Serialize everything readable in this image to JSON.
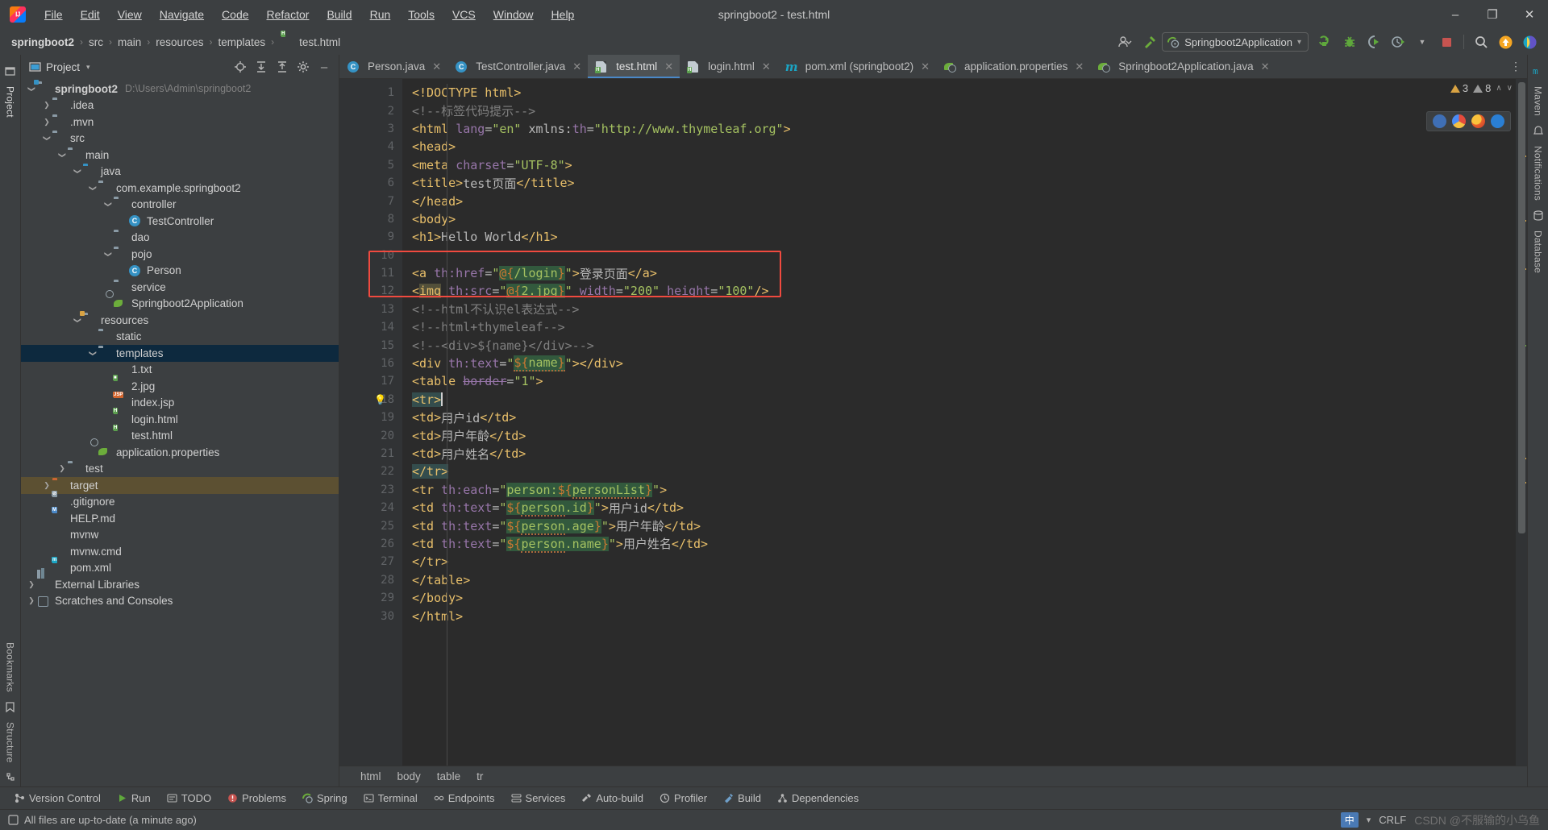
{
  "window": {
    "title": "springboot2 - test.html",
    "minimize_label": "–",
    "maximize_label": "❐",
    "close_label": "✕"
  },
  "menu": {
    "items": [
      {
        "label": "File"
      },
      {
        "label": "Edit"
      },
      {
        "label": "View"
      },
      {
        "label": "Navigate"
      },
      {
        "label": "Code"
      },
      {
        "label": "Refactor"
      },
      {
        "label": "Build"
      },
      {
        "label": "Run"
      },
      {
        "label": "Tools"
      },
      {
        "label": "VCS"
      },
      {
        "label": "Window"
      },
      {
        "label": "Help"
      }
    ]
  },
  "navbar": {
    "crumbs": [
      "springboot2",
      "src",
      "main",
      "resources",
      "templates",
      "test.html"
    ],
    "separator": "›",
    "run_config": "Springboot2Application",
    "run_config_caret": "▾",
    "icons": [
      "user-settings-icon",
      "hammer-icon",
      "run-icon",
      "debug-icon",
      "run-with-coverage-icon",
      "profile-icon",
      "stop-icon",
      "search-everywhere-icon",
      "updates-icon",
      "ide-feature-icon"
    ]
  },
  "rail_left": {
    "top_labels": [
      "Project"
    ],
    "bottom_labels": [
      "Bookmarks",
      "Structure"
    ]
  },
  "rail_right": {
    "labels": [
      "Maven",
      "Notifications",
      "Database"
    ]
  },
  "project_panel": {
    "title": "Project",
    "caret": "▾",
    "toolbar_icons": [
      "locate-icon",
      "expand-all-icon",
      "collapse-all-icon",
      "settings-gear-icon",
      "hide-icon"
    ],
    "tree": [
      {
        "depth": 0,
        "arrow": "∨",
        "icon": "module-folder",
        "label": "springboot2",
        "bold": true,
        "path": "D:\\Users\\Admin\\springboot2"
      },
      {
        "depth": 1,
        "arrow": "›",
        "icon": "folder",
        "label": ".idea"
      },
      {
        "depth": 1,
        "arrow": "›",
        "icon": "folder",
        "label": ".mvn"
      },
      {
        "depth": 1,
        "arrow": "∨",
        "icon": "folder",
        "label": "src"
      },
      {
        "depth": 2,
        "arrow": "∨",
        "icon": "folder",
        "label": "main"
      },
      {
        "depth": 3,
        "arrow": "∨",
        "icon": "folder-blue",
        "label": "java"
      },
      {
        "depth": 4,
        "arrow": "∨",
        "icon": "package",
        "label": "com.example.springboot2"
      },
      {
        "depth": 5,
        "arrow": "∨",
        "icon": "package",
        "label": "controller"
      },
      {
        "depth": 6,
        "arrow": "",
        "icon": "class",
        "label": "TestController"
      },
      {
        "depth": 5,
        "arrow": "",
        "icon": "package",
        "label": "dao"
      },
      {
        "depth": 5,
        "arrow": "∨",
        "icon": "package",
        "label": "pojo"
      },
      {
        "depth": 6,
        "arrow": "",
        "icon": "class",
        "label": "Person"
      },
      {
        "depth": 5,
        "arrow": "",
        "icon": "package",
        "label": "service"
      },
      {
        "depth": 5,
        "arrow": "",
        "icon": "spring",
        "label": "Springboot2Application"
      },
      {
        "depth": 3,
        "arrow": "∨",
        "icon": "resources-folder",
        "label": "resources"
      },
      {
        "depth": 4,
        "arrow": "",
        "icon": "folder",
        "label": "static"
      },
      {
        "depth": 4,
        "arrow": "∨",
        "icon": "folder",
        "label": "templates",
        "selected": true
      },
      {
        "depth": 5,
        "arrow": "",
        "icon": "file-txt",
        "label": "1.txt"
      },
      {
        "depth": 5,
        "arrow": "",
        "icon": "file-img",
        "label": "2.jpg"
      },
      {
        "depth": 5,
        "arrow": "",
        "icon": "file-jsp",
        "label": "index.jsp"
      },
      {
        "depth": 5,
        "arrow": "",
        "icon": "file-html",
        "label": "login.html"
      },
      {
        "depth": 5,
        "arrow": "",
        "icon": "file-html",
        "label": "test.html"
      },
      {
        "depth": 4,
        "arrow": "",
        "icon": "spring",
        "label": "application.properties"
      },
      {
        "depth": 2,
        "arrow": "›",
        "icon": "folder",
        "label": "test"
      },
      {
        "depth": 1,
        "arrow": "›",
        "icon": "folder-orange",
        "label": "target",
        "excluded": true
      },
      {
        "depth": 1,
        "arrow": "",
        "icon": "file-ignore",
        "label": ".gitignore"
      },
      {
        "depth": 1,
        "arrow": "",
        "icon": "file-md",
        "label": "HELP.md"
      },
      {
        "depth": 1,
        "arrow": "",
        "icon": "file-txt",
        "label": "mvnw"
      },
      {
        "depth": 1,
        "arrow": "",
        "icon": "file-txt",
        "label": "mvnw.cmd"
      },
      {
        "depth": 1,
        "arrow": "",
        "icon": "file-maven",
        "label": "pom.xml"
      },
      {
        "depth": 0,
        "arrow": "›",
        "icon": "libraries",
        "label": "External Libraries"
      },
      {
        "depth": 0,
        "arrow": "›",
        "icon": "scratches",
        "label": "Scratches and Consoles"
      }
    ]
  },
  "editor": {
    "tabs": [
      {
        "label": "Person.java",
        "icon": "class-icon",
        "active": false
      },
      {
        "label": "TestController.java",
        "icon": "class-icon",
        "active": false
      },
      {
        "label": "test.html",
        "icon": "html-icon",
        "active": true
      },
      {
        "label": "login.html",
        "icon": "html-icon",
        "active": false
      },
      {
        "label": "pom.xml (springboot2)",
        "icon": "maven-icon",
        "active": false
      },
      {
        "label": "application.properties",
        "icon": "spring-icon",
        "active": false
      },
      {
        "label": "Springboot2Application.java",
        "icon": "spring-run-icon",
        "active": false
      }
    ],
    "tab_close_label": "✕",
    "overflow_label": "⋮",
    "inspection": {
      "warnings": "3",
      "weak_warnings": "8",
      "warn_icon": "warning-triangle-icon",
      "weak_icon": "weak-warning-icon",
      "caret_up": "∧",
      "caret_down": "∨"
    },
    "browsers": [
      "ie-browser-icon",
      "chrome-browser-icon",
      "firefox-browser-icon",
      "opera-browser-icon"
    ],
    "breadcrumb": [
      "html",
      "body",
      "table",
      "tr"
    ],
    "line_numbers": [
      1,
      2,
      3,
      4,
      5,
      6,
      7,
      8,
      9,
      10,
      11,
      12,
      13,
      14,
      15,
      16,
      17,
      18,
      19,
      20,
      21,
      22,
      23,
      24,
      25,
      26,
      27,
      28,
      29,
      30
    ],
    "lines": [
      {
        "n": 1,
        "fold": "",
        "html": "<span class=\"t-tag\">&lt;!DOCTYPE html&gt;</span>"
      },
      {
        "n": 2,
        "fold": "",
        "html": "<span class=\"t-cmt\">&lt;!--标签代码提示--&gt;</span>"
      },
      {
        "n": 3,
        "fold": "−",
        "html": "<span class=\"t-tag\">&lt;html </span><span class=\"t-attr\">lang</span><span class=\"t-punc\">=</span><span class=\"t-val\">\"en\"</span><span class=\"t-tag\"> </span><span class=\"t-punc\">xmlns:</span><span class=\"t-attr\">th</span><span class=\"t-punc\">=</span><span class=\"t-val\">\"http://www.thymeleaf.org\"</span><span class=\"t-tag\">&gt;</span>"
      },
      {
        "n": 4,
        "fold": "−",
        "html": "<span class=\"t-tag\">&lt;head&gt;</span>"
      },
      {
        "n": 5,
        "fold": "",
        "html": "    <span class=\"t-tag\">&lt;meta </span><span class=\"t-attr\">charset</span><span class=\"t-punc\">=</span><span class=\"t-val\">\"UTF-8\"</span><span class=\"t-tag\">&gt;</span>"
      },
      {
        "n": 6,
        "fold": "",
        "html": "    <span class=\"t-tag\">&lt;title&gt;</span><span class=\"t-txt\">test页面</span><span class=\"t-tag\">&lt;/title&gt;</span>"
      },
      {
        "n": 7,
        "fold": "⌃",
        "html": "<span class=\"t-tag\">&lt;/head&gt;</span>"
      },
      {
        "n": 8,
        "fold": "−",
        "html": "<span class=\"t-tag\">&lt;body&gt;</span>"
      },
      {
        "n": 9,
        "fold": "",
        "html": "<span class=\"t-tag\">&lt;h1&gt;</span><span class=\"t-txt\">Hello World</span><span class=\"t-tag\">&lt;/h1&gt;</span>"
      },
      {
        "n": 10,
        "fold": "",
        "html": ""
      },
      {
        "n": 11,
        "fold": "",
        "html": "<span class=\"t-tag\">&lt;a </span><span class=\"t-attr\">th:href</span><span class=\"t-punc\">=</span><span class=\"t-val\">\"</span><span class=\"hl-green\"><span class=\"t-el\">@{</span><span class=\"t-val\">/login</span><span class=\"t-el\">}</span></span><span class=\"t-val\">\"</span><span class=\"t-tag\">&gt;</span><span class=\"t-txt\">登录页面</span><span class=\"t-tag\">&lt;/a&gt;</span>"
      },
      {
        "n": 12,
        "fold": "",
        "html": "<span class=\"t-tag\">&lt;</span><span class=\"hl-olive\"><span class=\"t-tag\">img</span></span><span class=\"t-tag\"> </span><span class=\"t-attr\">th:src</span><span class=\"t-punc\">=</span><span class=\"t-val\">\"</span><span class=\"hl-green\"><span class=\"t-el\">@{</span><span class=\"t-val\">2.jpg</span><span class=\"t-el\">}</span></span><span class=\"t-val\">\"</span><span class=\"t-tag\"> </span><span class=\"t-attr\">width</span><span class=\"t-punc\">=</span><span class=\"t-val\">\"200\"</span><span class=\"t-tag\"> </span><span class=\"t-attr\">height</span><span class=\"t-punc\">=</span><span class=\"t-val\">\"100\"</span><span class=\"t-tag\">/&gt;</span>"
      },
      {
        "n": 13,
        "fold": "",
        "html": "<span class=\"t-cmt\">&lt;!--html不认识el表达式--&gt;</span>"
      },
      {
        "n": 14,
        "fold": "",
        "html": "<span class=\"t-cmt\">&lt;!--html+thymeleaf--&gt;</span>"
      },
      {
        "n": 15,
        "fold": "",
        "html": "<span class=\"t-cmt\">&lt;!--&lt;div&gt;${name}&lt;/div&gt;--&gt;</span>"
      },
      {
        "n": 16,
        "fold": "",
        "html": "<span class=\"t-tag\">&lt;div </span><span class=\"t-attr\">th:text</span><span class=\"t-punc\">=</span><span class=\"t-val\">\"</span><span class=\"hl-green wavy\"><span class=\"t-el\">${</span><span class=\"t-val\">name</span><span class=\"t-el\">}</span></span><span class=\"t-val\">\"</span><span class=\"t-tag\">&gt;&lt;/div&gt;</span>"
      },
      {
        "n": 17,
        "fold": "−",
        "html": "<span class=\"t-tag\">&lt;table </span><span class=\"t-attr strike\">border</span><span class=\"t-punc\">=</span><span class=\"t-val\">\"1\"</span><span class=\"t-tag\">&gt;</span>"
      },
      {
        "n": 18,
        "fold": "−",
        "bulb": true,
        "html": "  <span class=\"hl-teal\"><span class=\"t-tag\">&lt;tr&gt;</span></span><span class=\"caret\"></span>"
      },
      {
        "n": 19,
        "fold": "",
        "html": "      <span class=\"t-tag\">&lt;td&gt;</span><span class=\"t-txt\">用户id</span><span class=\"t-tag\">&lt;/td&gt;</span>"
      },
      {
        "n": 20,
        "fold": "",
        "html": "      <span class=\"t-tag\">&lt;td&gt;</span><span class=\"t-txt\">用户年龄</span><span class=\"t-tag\">&lt;/td&gt;</span>"
      },
      {
        "n": 21,
        "fold": "",
        "html": "      <span class=\"t-tag\">&lt;td&gt;</span><span class=\"t-txt\">用户姓名</span><span class=\"t-tag\">&lt;/td&gt;</span>"
      },
      {
        "n": 22,
        "fold": "⌃",
        "html": "  <span class=\"hl-teal\"><span class=\"t-tag\">&lt;/tr&gt;</span></span>"
      },
      {
        "n": 23,
        "fold": "−",
        "html": "  <span class=\"t-tag\">&lt;tr </span><span class=\"t-attr\">th:each</span><span class=\"t-punc\">=</span><span class=\"t-val\">\"</span><span class=\"hl-green\"><span class=\"t-val\">person:</span><span class=\"t-el\">${</span><span class=\"t-val wavy\">personList</span><span class=\"t-el\">}</span></span><span class=\"t-val\">\"</span><span class=\"t-tag\">&gt;</span>"
      },
      {
        "n": 24,
        "fold": "",
        "html": "      <span class=\"t-tag\">&lt;td </span><span class=\"t-attr\">th:text</span><span class=\"t-punc\">=</span><span class=\"t-val\">\"</span><span class=\"hl-green\"><span class=\"t-el\">${</span><span class=\"t-val wavy\">person</span><span class=\"t-val\">.id</span><span class=\"t-el\">}</span></span><span class=\"t-val\">\"</span><span class=\"t-tag\">&gt;</span><span class=\"t-txt\">用户id</span><span class=\"t-tag\">&lt;/td&gt;</span>"
      },
      {
        "n": 25,
        "fold": "",
        "html": "      <span class=\"t-tag\">&lt;td </span><span class=\"t-attr\">th:text</span><span class=\"t-punc\">=</span><span class=\"t-val\">\"</span><span class=\"hl-green\"><span class=\"t-el\">${</span><span class=\"t-val wavy\">person</span><span class=\"t-val\">.age</span><span class=\"t-el\">}</span></span><span class=\"t-val\">\"</span><span class=\"t-tag\">&gt;</span><span class=\"t-txt\">用户年龄</span><span class=\"t-tag\">&lt;/td&gt;</span>"
      },
      {
        "n": 26,
        "fold": "",
        "html": "      <span class=\"t-tag\">&lt;td </span><span class=\"t-attr\">th:text</span><span class=\"t-punc\">=</span><span class=\"t-val\">\"</span><span class=\"hl-green\"><span class=\"t-el\">${</span><span class=\"t-val wavy\">person</span><span class=\"t-val\">.name</span><span class=\"t-el\">}</span></span><span class=\"t-val\">\"</span><span class=\"t-tag\">&gt;</span><span class=\"t-txt\">用户姓名</span><span class=\"t-tag\">&lt;/td&gt;</span>"
      },
      {
        "n": 27,
        "fold": "⌃",
        "html": "  <span class=\"t-tag\">&lt;/tr&gt;</span>"
      },
      {
        "n": 28,
        "fold": "⌃",
        "html": "<span class=\"t-tag\">&lt;/table&gt;</span>"
      },
      {
        "n": 29,
        "fold": "⌃",
        "html": "<span class=\"t-tag\">&lt;/body&gt;</span>"
      },
      {
        "n": 30,
        "fold": "⌃",
        "html": "<span class=\"t-tag\">&lt;/html&gt;</span>"
      }
    ]
  },
  "bottom_tools": [
    {
      "label": "Version Control",
      "icon": "branch-icon"
    },
    {
      "label": "Run",
      "icon": "run-icon"
    },
    {
      "label": "TODO",
      "icon": "todo-icon"
    },
    {
      "label": "Problems",
      "icon": "problems-icon"
    },
    {
      "label": "Spring",
      "icon": "spring-icon"
    },
    {
      "label": "Terminal",
      "icon": "terminal-icon"
    },
    {
      "label": "Endpoints",
      "icon": "endpoints-icon"
    },
    {
      "label": "Services",
      "icon": "services-icon"
    },
    {
      "label": "Auto-build",
      "icon": "auto-build-icon"
    },
    {
      "label": "Profiler",
      "icon": "profiler-icon"
    },
    {
      "label": "Build",
      "icon": "build-icon"
    },
    {
      "label": "Dependencies",
      "icon": "dependencies-icon"
    }
  ],
  "status": {
    "message": "All files are up-to-date (a minute ago)",
    "icon": "sync-icon",
    "ime": "中",
    "ime_extra": "▾",
    "watermark": "CSDN @不服输的小乌鱼",
    "crlf": "CRLF"
  },
  "colors": {
    "accent": "#4a88c7",
    "selection": "#0d293e",
    "excluded": "#5c5032",
    "annotation_box": "#f04a3f",
    "editor_bg": "#2b2b2b",
    "panel_bg": "#3c3f41"
  }
}
